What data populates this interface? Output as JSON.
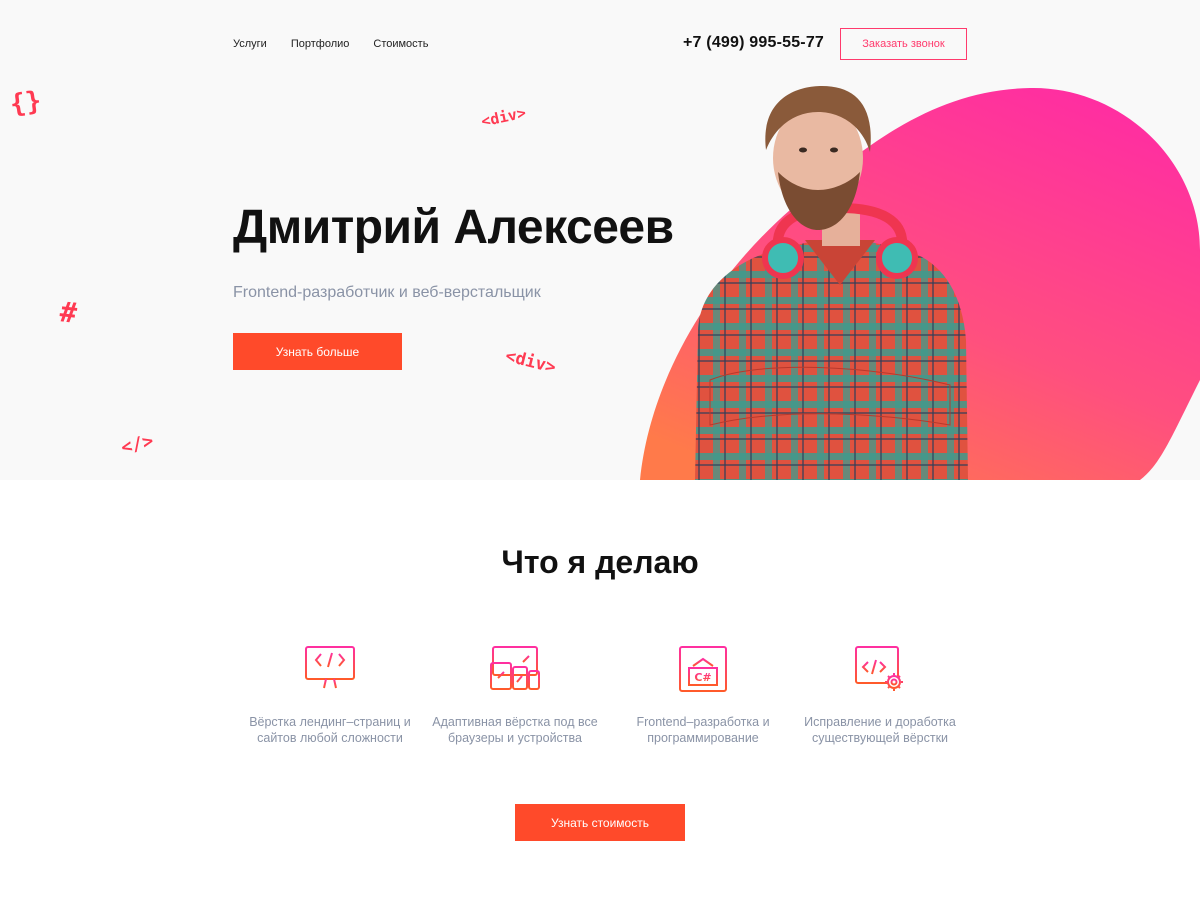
{
  "nav": {
    "items": [
      {
        "label": "Услуги"
      },
      {
        "label": "Портфолио"
      },
      {
        "label": "Стоимость"
      }
    ],
    "phone": "+7 (499) 995-55-77",
    "call_button": "Заказать звонок"
  },
  "hero": {
    "name": "Дмитрий Алексеев",
    "subtitle": "Frontend-разработчик и веб-верстальщик",
    "button": "Узнать больше",
    "decorations": [
      "{}",
      "<div>",
      "#",
      "<div>",
      "</>"
    ]
  },
  "services": {
    "title": "Что я делаю",
    "items": [
      {
        "icon": "monitor-code-icon",
        "line1": "Вёрстка лендинг–страниц и",
        "line2": "сайтов любой сложности"
      },
      {
        "icon": "responsive-devices-icon",
        "line1": "Адаптивная вёрстка под все",
        "line2": "браузеры и устройства"
      },
      {
        "icon": "csharp-window-icon",
        "line1": "Frontend–разработка и",
        "line2": "программирование"
      },
      {
        "icon": "browser-gear-icon",
        "line1": "Исправление и доработка",
        "line2": "существующей вёрстки"
      }
    ],
    "button": "Узнать стоимость"
  },
  "colors": {
    "accent": "#ff4a2a",
    "pink": "#ff3a6d",
    "muted_text": "#8a93a6"
  }
}
